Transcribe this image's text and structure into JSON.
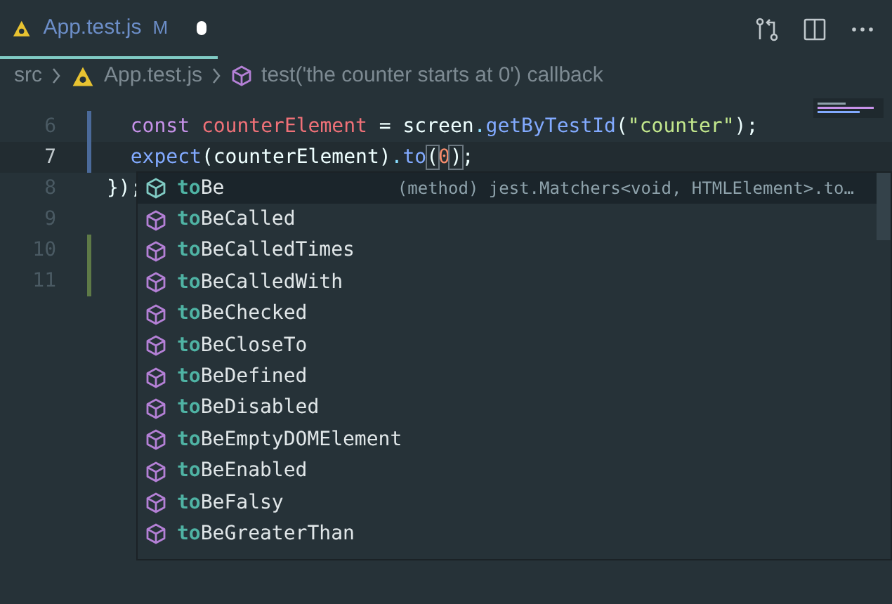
{
  "tabs": [
    {
      "label": "App.test.js",
      "git_status": "M",
      "modified": true,
      "selected": true
    }
  ],
  "breadcrumbs": [
    {
      "label": "src",
      "kind": "folder"
    },
    {
      "label": "App.test.js",
      "kind": "file"
    },
    {
      "label": "test('the counter starts at 0') callback",
      "kind": "symbol"
    }
  ],
  "editor": {
    "lines": [
      {
        "number": "6",
        "modified": true,
        "added": false,
        "current": false,
        "tokens": [
          {
            "text": "  const ",
            "kind": "keyword"
          },
          {
            "text": "counterElement",
            "kind": "variable"
          },
          {
            "text": " = ",
            "kind": "plain"
          },
          {
            "text": "screen",
            "kind": "plain"
          },
          {
            "text": ".",
            "kind": "punct"
          },
          {
            "text": "getByTestId",
            "kind": "function"
          },
          {
            "text": "(",
            "kind": "plain"
          },
          {
            "text": "\"counter\"",
            "kind": "string"
          },
          {
            "text": ");",
            "kind": "plain"
          }
        ]
      },
      {
        "number": "7",
        "modified": true,
        "added": false,
        "current": true,
        "tokens": [
          {
            "text": "  expect",
            "kind": "function"
          },
          {
            "text": "(counterElement)",
            "kind": "plain"
          },
          {
            "text": ".",
            "kind": "punct"
          },
          {
            "text": "to",
            "kind": "function"
          },
          {
            "text": "(",
            "kind": "bracket"
          },
          {
            "text": "0",
            "kind": "number"
          },
          {
            "text": ")",
            "kind": "bracket"
          },
          {
            "text": ";",
            "kind": "plain"
          }
        ]
      },
      {
        "number": "8",
        "modified": false,
        "added": false,
        "current": false,
        "tokens": [
          {
            "text": "});",
            "kind": "plain"
          }
        ]
      },
      {
        "number": "9",
        "modified": false,
        "added": false,
        "current": false
      },
      {
        "number": "10",
        "modified": false,
        "added": true,
        "current": false
      },
      {
        "number": "11",
        "modified": false,
        "added": true,
        "current": false
      }
    ]
  },
  "suggestions": {
    "detail": "(method) jest.Matchers<void, HTMLElement>.to…",
    "items": [
      {
        "match": "to",
        "rest": "Be",
        "selected": true
      },
      {
        "match": "to",
        "rest": "BeCalled",
        "selected": false
      },
      {
        "match": "to",
        "rest": "BeCalledTimes",
        "selected": false
      },
      {
        "match": "to",
        "rest": "BeCalledWith",
        "selected": false
      },
      {
        "match": "to",
        "rest": "BeChecked",
        "selected": false
      },
      {
        "match": "to",
        "rest": "BeCloseTo",
        "selected": false
      },
      {
        "match": "to",
        "rest": "BeDefined",
        "selected": false
      },
      {
        "match": "to",
        "rest": "BeDisabled",
        "selected": false
      },
      {
        "match": "to",
        "rest": "BeEmptyDOMElement",
        "selected": false
      },
      {
        "match": "to",
        "rest": "BeEnabled",
        "selected": false
      },
      {
        "match": "to",
        "rest": "BeFalsy",
        "selected": false
      },
      {
        "match": "to",
        "rest": "BeGreaterThan",
        "selected": false
      }
    ]
  }
}
